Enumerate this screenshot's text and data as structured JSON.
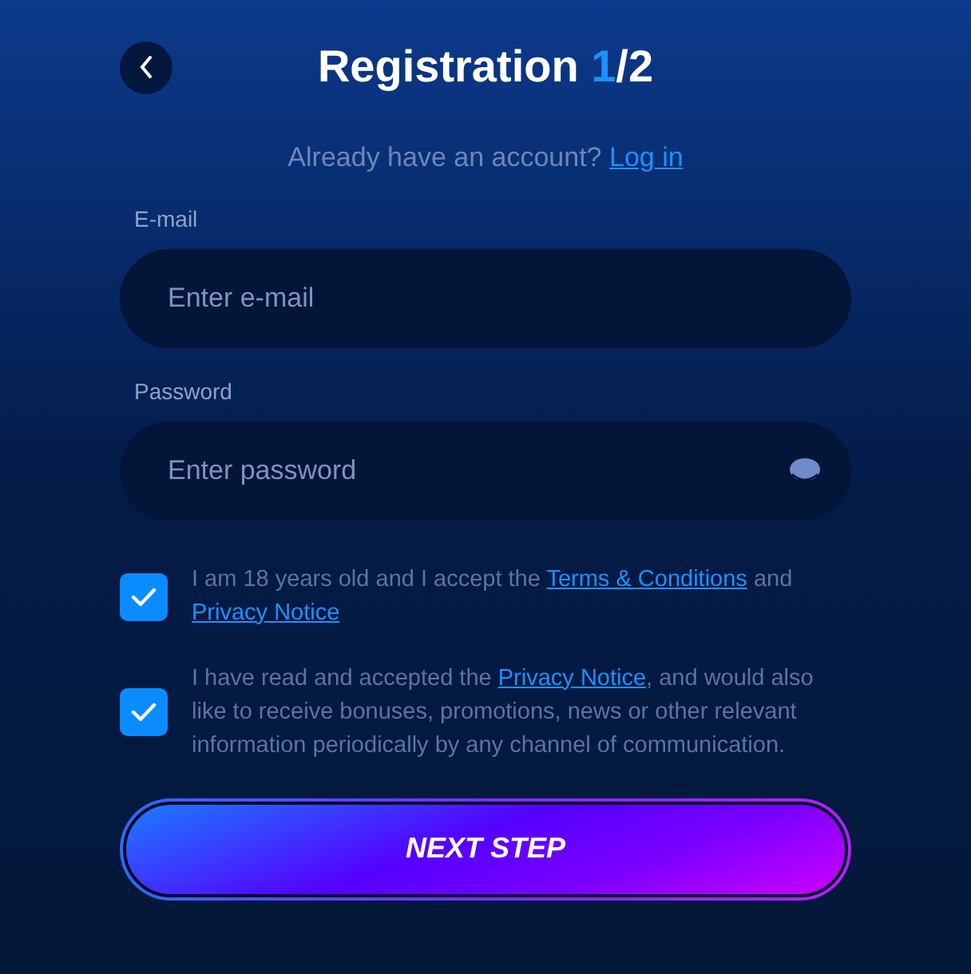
{
  "header": {
    "title": "Registration",
    "step": "1",
    "total": "/2"
  },
  "login_prompt": {
    "text": "Already have an account?",
    "link": "Log in"
  },
  "fields": [
    {
      "label": "E-mail",
      "placeholder": "Enter e-mail",
      "kind": "text"
    },
    {
      "label": "Password",
      "placeholder": "Enter password",
      "kind": "password"
    }
  ],
  "consents": [
    {
      "checked": true,
      "parts": [
        {
          "kind": "text",
          "text": "I am 18 years old and I accept the "
        },
        {
          "kind": "link",
          "text": "Terms & Conditions"
        },
        {
          "kind": "text",
          "text": " and "
        },
        {
          "kind": "link",
          "text": "Privacy Notice"
        }
      ]
    },
    {
      "checked": true,
      "parts": [
        {
          "kind": "text",
          "text": "I have read and accepted the "
        },
        {
          "kind": "link",
          "text": "Privacy Notice"
        },
        {
          "kind": "text",
          "text": ", and would also like to receive bonuses, promotions, news or other relevant information periodically by any channel of communication."
        }
      ]
    }
  ],
  "submit": "NEXT STEP"
}
